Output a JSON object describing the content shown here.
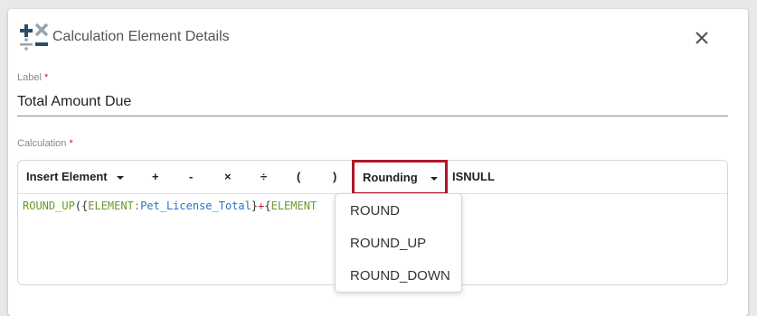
{
  "dialog": {
    "title": "Calculation Element Details",
    "close_icon": "close-icon",
    "app_icon": "calculator-operators-icon"
  },
  "label_field": {
    "caption": "Label",
    "required_mark": "*",
    "value": "Total Amount Due"
  },
  "calculation_field": {
    "caption": "Calculation",
    "required_mark": "*"
  },
  "toolbar": {
    "insert_element": "Insert Element",
    "plus": "+",
    "minus": "-",
    "multiply": "×",
    "divide": "÷",
    "open_paren": "(",
    "close_paren": ")",
    "rounding": "Rounding",
    "isnull": "ISNULL"
  },
  "formula": {
    "fn": "ROUND_UP",
    "open": "({",
    "kw1": "ELEMENT",
    "colon1": ":",
    "ref1": "Pet_License_Total",
    "close1": "}",
    "op": "+",
    "open2": "{",
    "kw2": "ELEMENT"
  },
  "rounding_menu": {
    "options": [
      "ROUND",
      "ROUND_UP",
      "ROUND_DOWN"
    ]
  },
  "colors": {
    "highlight": "#b0162a",
    "function": "#6a9a2c",
    "reference": "#2b73c4",
    "operator": "#c0262d"
  }
}
